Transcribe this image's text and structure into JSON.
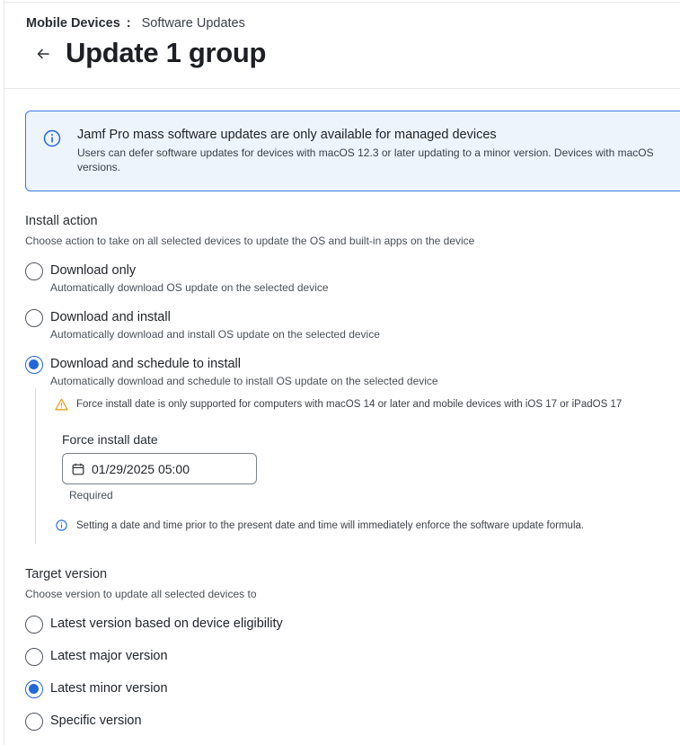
{
  "breadcrumb": {
    "root": "Mobile Devices",
    "separator": ":",
    "current": "Software Updates"
  },
  "header": {
    "title": "Update 1 group"
  },
  "banner": {
    "title": "Jamf Pro mass software updates are only available for managed devices",
    "text": "Users can defer software updates for devices with macOS 12.3 or later updating to a minor version. Devices with macOS versions."
  },
  "install_action": {
    "label": "Install action",
    "description": "Choose action to take on all selected devices to update the OS and built-in apps on the device",
    "options": [
      {
        "label": "Download only",
        "sub": "Automatically download OS update on the selected device",
        "checked": false
      },
      {
        "label": "Download and install",
        "sub": "Automatically download and install OS update on the selected device",
        "checked": false
      },
      {
        "label": "Download and schedule to install",
        "sub": "Automatically download and schedule to install OS update on the selected device",
        "checked": true
      }
    ],
    "warning": "Force install date is only supported for computers with macOS 14 or later and mobile devices with iOS 17 or iPadOS 17",
    "force_install": {
      "label": "Force install date",
      "value": "01/29/2025 05:00",
      "helper": "Required",
      "info": "Setting a date and time prior to the present date and time will immediately enforce the software update formula."
    }
  },
  "target_version": {
    "label": "Target version",
    "description": "Choose version to update all selected devices to",
    "options": [
      {
        "label": "Latest version based on device eligibility",
        "checked": false
      },
      {
        "label": "Latest major version",
        "checked": false
      },
      {
        "label": "Latest minor version",
        "checked": true
      },
      {
        "label": "Specific version",
        "checked": false
      }
    ]
  },
  "colors": {
    "accent": "#2368d8",
    "banner_border": "#3a7be0",
    "banner_bg": "#eef4fc",
    "warning": "#e8a317"
  },
  "icons": [
    "arrow-left-icon",
    "info-circle-icon",
    "warning-triangle-icon",
    "calendar-icon"
  ]
}
